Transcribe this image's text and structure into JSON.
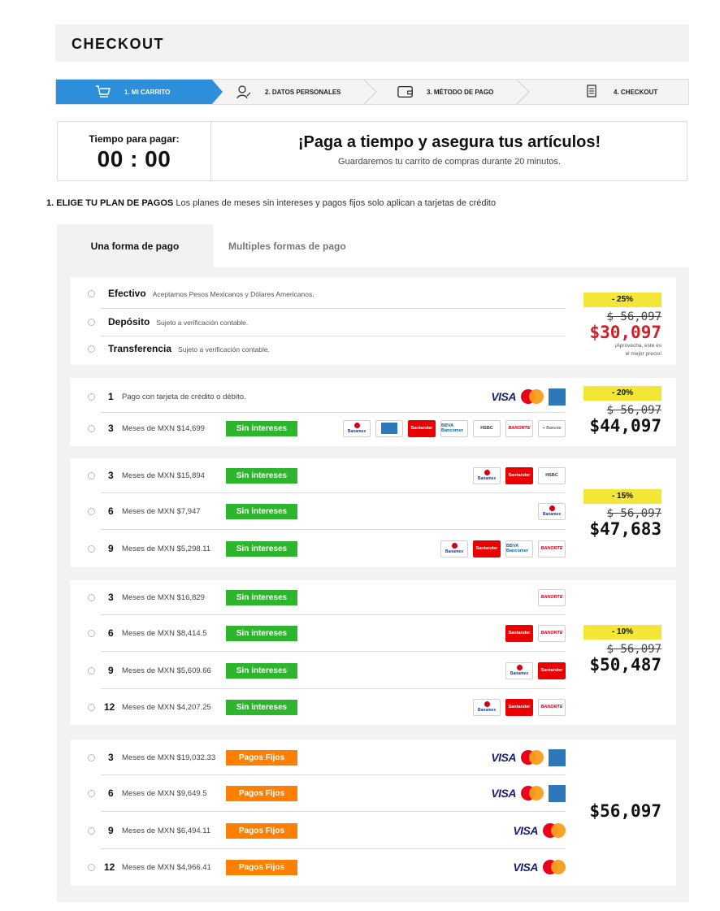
{
  "header": {
    "title": "CHECKOUT"
  },
  "steps": [
    {
      "label": "1. MI CARRITO",
      "icon": "cart-icon"
    },
    {
      "label": "2. DATOS PERSONALES",
      "icon": "user-edit-icon"
    },
    {
      "label": "3. MÉTODO DE PAGO",
      "icon": "wallet-icon"
    },
    {
      "label": "4. CHECKOUT",
      "icon": "receipt-icon"
    }
  ],
  "timer": {
    "label": "Tiempo para pagar:",
    "time": "00 : 00",
    "headline": "¡Paga a tiempo y asegura tus artículos!",
    "subtext": "Guardaremos tu carrito de compras durante 20 minutos."
  },
  "plan": {
    "title": "1. ELIGE TU PLAN DE PAGOS",
    "subtitle": "Los planes de meses sin intereses y pagos fijos solo aplican a tarjetas de crédito"
  },
  "tabs": {
    "one": "Una forma de pago",
    "multi": "Multiples formas de pago"
  },
  "cash": {
    "rows": [
      {
        "name": "Efectivo",
        "note": "Aceptamos Pesos Mexicanos y Dólares Americanos."
      },
      {
        "name": "Depósito",
        "note": "Sujeto a verificación contable."
      },
      {
        "name": "Transferencia",
        "note": "Sujeto a verificación contable."
      }
    ],
    "discount": "- 25%",
    "old_price": "$ 56,097",
    "new_price": "$30,097",
    "promo1": "¡Aprovecha, este es",
    "promo2": "el mejor precio!"
  },
  "card1": {
    "row1": {
      "num": "1",
      "desc": "Pago con tarjeta de crédito o débito."
    },
    "row2": {
      "num": "3",
      "desc": "Meses de MXN $14,699",
      "badge": "Sin intereses"
    },
    "discount": "- 20%",
    "old_price": "$ 56,097",
    "new_price": "$44,097",
    "visa": "VISA",
    "mas_bancos": "+ Bancos",
    "banks": {
      "banamex": "Banamex",
      "santander": "Santander",
      "bbva": "BBVA Bancomer",
      "hsbc": "HSBC",
      "banorte": "BANORTE"
    }
  },
  "card2": {
    "rows": [
      {
        "num": "3",
        "desc": "Meses de MXN $15,894",
        "badge": "Sin intereses"
      },
      {
        "num": "6",
        "desc": "Meses de MXN $7,947",
        "badge": "Sin intereses"
      },
      {
        "num": "9",
        "desc": "Meses de MXN $5,298.11",
        "badge": "Sin intereses"
      }
    ],
    "discount": "- 15%",
    "old_price": "$ 56,097",
    "new_price": "$47,683"
  },
  "card3": {
    "rows": [
      {
        "num": "3",
        "desc": "Meses de MXN $16,829",
        "badge": "Sin intereses"
      },
      {
        "num": "6",
        "desc": "Meses de MXN $8,414.5",
        "badge": "Sin intereses"
      },
      {
        "num": "9",
        "desc": "Meses de MXN $5,609.66",
        "badge": "Sin intereses"
      },
      {
        "num": "12",
        "desc": "Meses de MXN $4,207.25",
        "badge": "Sin intereses"
      }
    ],
    "discount": "- 10%",
    "old_price": "$ 56,097",
    "new_price": "$50,487"
  },
  "card4": {
    "rows": [
      {
        "num": "3",
        "desc": "Meses de MXN $19,032.33",
        "badge": "Pagos Fijos"
      },
      {
        "num": "6",
        "desc": "Meses de MXN $9,649.5",
        "badge": "Pagos Fijos"
      },
      {
        "num": "9",
        "desc": "Meses de MXN $6,494.11",
        "badge": "Pagos Fijos"
      },
      {
        "num": "12",
        "desc": "Meses de MXN $4,966.41",
        "badge": "Pagos Fijos"
      }
    ],
    "price": "$56,097"
  },
  "colors": {
    "step_active": "#2d8fd9",
    "badge_green": "#2db52d",
    "badge_orange": "#ff7f00",
    "discount_yellow": "#f4e637",
    "price_red": "#d0202a"
  }
}
